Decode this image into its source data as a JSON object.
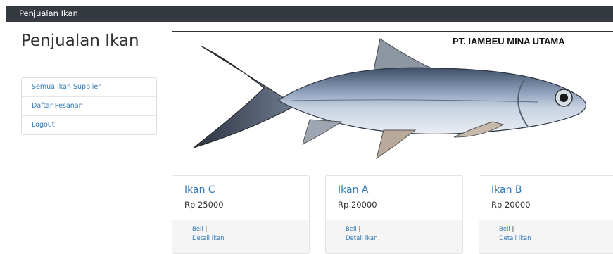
{
  "navbar": {
    "brand": "Penjualan Ikan"
  },
  "sidebar": {
    "title": "Penjualan Ikan",
    "items": [
      {
        "label": "Semua Ikan Supplier"
      },
      {
        "label": "Daftar Pesanan"
      },
      {
        "label": "Logout"
      }
    ]
  },
  "banner": {
    "company": "PT. IAMBEU MINA UTAMA"
  },
  "products": [
    {
      "name": "Ikan C",
      "price": "Rp 25000",
      "buy_label": "Beli",
      "separator": "|",
      "detail_label": "Detail ikan"
    },
    {
      "name": "Ikan A",
      "price": "Rp 20000",
      "buy_label": "Beli",
      "separator": "|",
      "detail_label": "Detail ikan"
    },
    {
      "name": "Ikan B",
      "price": "Rp 20000",
      "buy_label": "Beli",
      "separator": "|",
      "detail_label": "Detail ikan"
    }
  ],
  "colors": {
    "navbar": "#343a40",
    "link": "#337ab7"
  }
}
